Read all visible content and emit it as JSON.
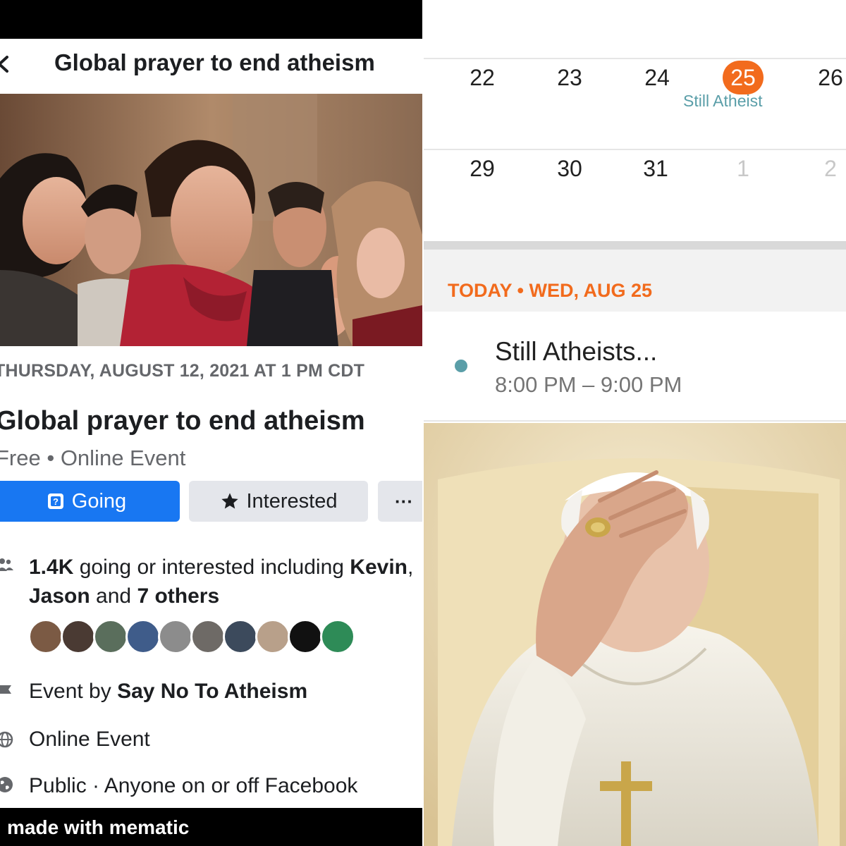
{
  "facebook_event": {
    "header_title": "Global prayer to end atheism",
    "date_line": "THURSDAY, AUGUST 12, 2021 AT 1 PM CDT",
    "title": "Global prayer to end atheism",
    "subtitle": "Free • Online Event",
    "buttons": {
      "going": "Going",
      "interested": "Interested",
      "more": "···"
    },
    "attendance": {
      "count": "1.4K",
      "text_mid": " going or interested including ",
      "name1": "Kevin",
      "comma": ",",
      "name2": "Jason",
      "and": " and ",
      "others": "7 others"
    },
    "organizer_prefix": "Event by ",
    "organizer": "Say No To Atheism",
    "location": "Online Event",
    "privacy": "Public · Anyone on or off Facebook",
    "icons": {
      "back": "chevron-left-icon",
      "going": "calendar-check-icon",
      "interested": "star-icon",
      "people": "people-icon",
      "flag": "flag-icon",
      "globe": "globe-icon",
      "public": "public-globe-icon"
    },
    "colors": {
      "primary": "#1877f2",
      "secondary_button": "#e4e6eb"
    }
  },
  "watermark": "made with mematic",
  "calendar": {
    "week1": [
      "22",
      "23",
      "24",
      "25",
      "26"
    ],
    "week2": [
      "29",
      "30",
      "31",
      "1",
      "2"
    ],
    "today_day": "25",
    "event_chip": "Still Atheist",
    "today_header": "TODAY • WED, AUG 25",
    "event": {
      "name": "Still Atheists...",
      "time": "8:00 PM – 9:00 PM"
    },
    "colors": {
      "accent": "#f26b1d",
      "event": "#5a9ea8"
    }
  },
  "photo_captions": {
    "crowd": "crowd-praying-photo",
    "pope": "pope-facepalm-photo"
  }
}
